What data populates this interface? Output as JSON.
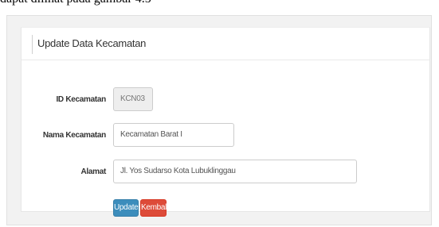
{
  "document": {
    "text_above": "dapat dilihat pada gambar 4.5"
  },
  "form": {
    "title": "Update Data Kecamatan",
    "fields": [
      {
        "label": "ID Kecamatan",
        "value": "KCN03",
        "disabled": true
      },
      {
        "label": "Nama Kecamatan",
        "value": "Kecamatan Barat I",
        "disabled": false
      },
      {
        "label": "Alamat",
        "value": "Jl. Yos Sudarso Kota Lubuklinggau",
        "disabled": false
      }
    ],
    "buttons": {
      "update_label": "Update",
      "back_label": "Kembali"
    }
  },
  "colors": {
    "primary": "#3c8dbc",
    "danger": "#dd4b39",
    "page_background": "#f2f2f2",
    "disabled_field": "#eeeeee"
  }
}
